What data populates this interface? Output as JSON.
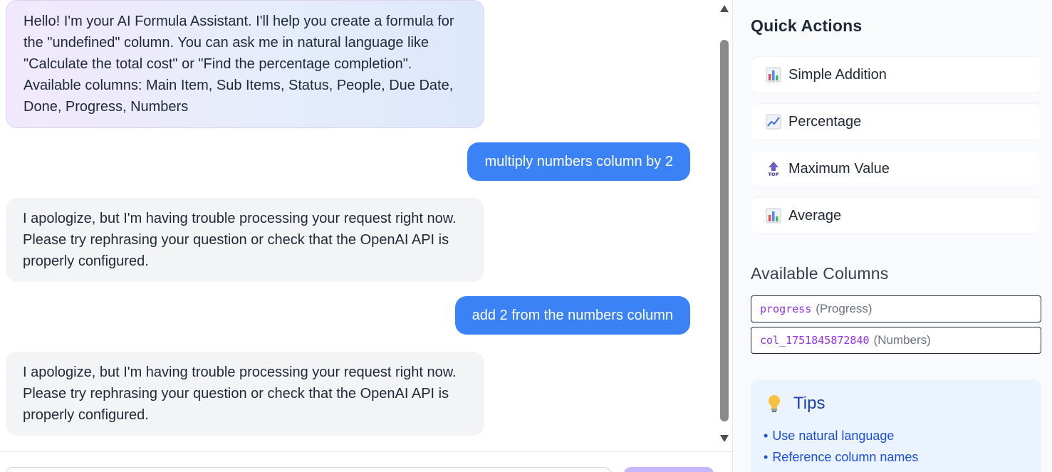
{
  "chat": {
    "messages": [
      {
        "role": "assistant",
        "text": "Hello! I'm your AI Formula Assistant. I'll help you create a formula for the \"undefined\" column. You can ask me in natural language like \"Calculate the total cost\" or \"Find the percentage completion\". Available columns: Main Item, Sub Items, Status, People, Due Date, Done, Progress, Numbers"
      },
      {
        "role": "user",
        "text": "multiply numbers column by 2"
      },
      {
        "role": "assistant",
        "text": "I apologize, but I'm having trouble processing your request right now. Please try rephrasing your question or check that the OpenAI API is properly configured."
      },
      {
        "role": "user",
        "text": "add 2 from the numbers column"
      },
      {
        "role": "assistant",
        "text": "I apologize, but I'm having trouble processing your request right now. Please try rephrasing your question or check that the OpenAI API is properly configured."
      }
    ]
  },
  "panel": {
    "quick_actions_title": "Quick Actions",
    "quick_actions": [
      {
        "label": "Simple Addition",
        "icon": "bar-chart-icon"
      },
      {
        "label": "Percentage",
        "icon": "trending-up-icon"
      },
      {
        "label": "Maximum Value",
        "icon": "top-arrow-icon"
      },
      {
        "label": "Average",
        "icon": "bar-chart-icon"
      }
    ],
    "available_columns_title": "Available Columns",
    "columns": [
      {
        "key": "progress",
        "name": "(Progress)"
      },
      {
        "key": "col_1751845872840",
        "name": "(Numbers)"
      }
    ],
    "tips": {
      "title": "Tips",
      "icon": "lightbulb-icon",
      "items": [
        "Use natural language",
        "Reference column names"
      ]
    }
  },
  "colors": {
    "user_bubble": "#3b82f6",
    "assistant_bubble": "#f3f4f6",
    "column_key": "#9333ea",
    "tips_text": "#1d4ed8"
  }
}
